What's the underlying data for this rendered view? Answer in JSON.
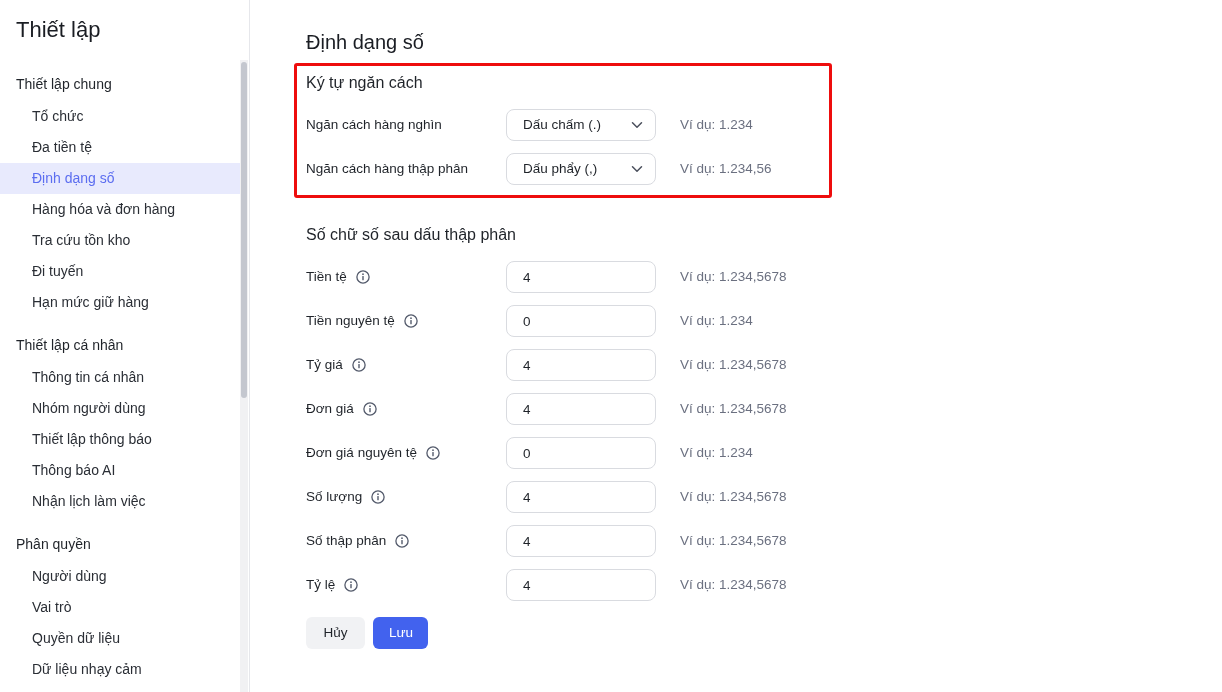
{
  "sidebar": {
    "title": "Thiết lập",
    "groups": [
      {
        "heading": "Thiết lập chung",
        "items": [
          {
            "label": "Tổ chức",
            "selected": false
          },
          {
            "label": "Đa tiền tệ",
            "selected": false
          },
          {
            "label": "Định dạng số",
            "selected": true
          },
          {
            "label": "Hàng hóa và đơn hàng",
            "selected": false
          },
          {
            "label": "Tra cứu tồn kho",
            "selected": false
          },
          {
            "label": "Đi tuyến",
            "selected": false
          },
          {
            "label": "Hạn mức giữ hàng",
            "selected": false
          }
        ]
      },
      {
        "heading": "Thiết lập cá nhân",
        "items": [
          {
            "label": "Thông tin cá nhân",
            "selected": false
          },
          {
            "label": "Nhóm người dùng",
            "selected": false
          },
          {
            "label": "Thiết lập thông báo",
            "selected": false
          },
          {
            "label": "Thông báo AI",
            "selected": false
          },
          {
            "label": "Nhận lịch làm việc",
            "selected": false
          }
        ]
      },
      {
        "heading": "Phân quyền",
        "items": [
          {
            "label": "Người dùng",
            "selected": false
          },
          {
            "label": "Vai trò",
            "selected": false
          },
          {
            "label": "Quyền dữ liệu",
            "selected": false
          },
          {
            "label": "Dữ liệu nhạy cảm",
            "selected": false
          }
        ]
      }
    ]
  },
  "page": {
    "title": "Định dạng số"
  },
  "sections": [
    {
      "title": "Ký tự ngăn cách",
      "highlighted": true,
      "rows": [
        {
          "kind": "select",
          "label": "Ngăn cách hàng nghìn",
          "info": false,
          "value": "Dấu chấm (.)",
          "example": "Ví dụ: 1.234"
        },
        {
          "kind": "select",
          "label": "Ngăn cách hàng thập phân",
          "info": false,
          "value": "Dấu phẩy (,)",
          "example": "Ví dụ: 1.234,56"
        }
      ]
    },
    {
      "title": "Số chữ số sau dấu thập phân",
      "highlighted": false,
      "rows": [
        {
          "kind": "number",
          "label": "Tiền tệ",
          "info": true,
          "value": "4",
          "example": "Ví dụ: 1.234,5678"
        },
        {
          "kind": "number",
          "label": "Tiền nguyên tệ",
          "info": true,
          "value": "0",
          "example": "Ví dụ: 1.234"
        },
        {
          "kind": "number",
          "label": "Tỷ giá",
          "info": true,
          "value": "4",
          "example": "Ví dụ: 1.234,5678"
        },
        {
          "kind": "number",
          "label": "Đơn giá",
          "info": true,
          "value": "4",
          "example": "Ví dụ: 1.234,5678"
        },
        {
          "kind": "number",
          "label": "Đơn giá nguyên tệ",
          "info": true,
          "value": "0",
          "example": "Ví dụ: 1.234"
        },
        {
          "kind": "number",
          "label": "Số lượng",
          "info": true,
          "value": "4",
          "example": "Ví dụ: 1.234,5678"
        },
        {
          "kind": "number",
          "label": "Số thập phân",
          "info": true,
          "value": "4",
          "example": "Ví dụ: 1.234,5678"
        },
        {
          "kind": "number",
          "label": "Tỷ lệ",
          "info": true,
          "value": "4",
          "example": "Ví dụ: 1.234,5678"
        }
      ]
    }
  ],
  "buttons": [
    {
      "kind": "secondary",
      "label": "Hủy"
    },
    {
      "kind": "primary",
      "label": "Lưu"
    }
  ]
}
